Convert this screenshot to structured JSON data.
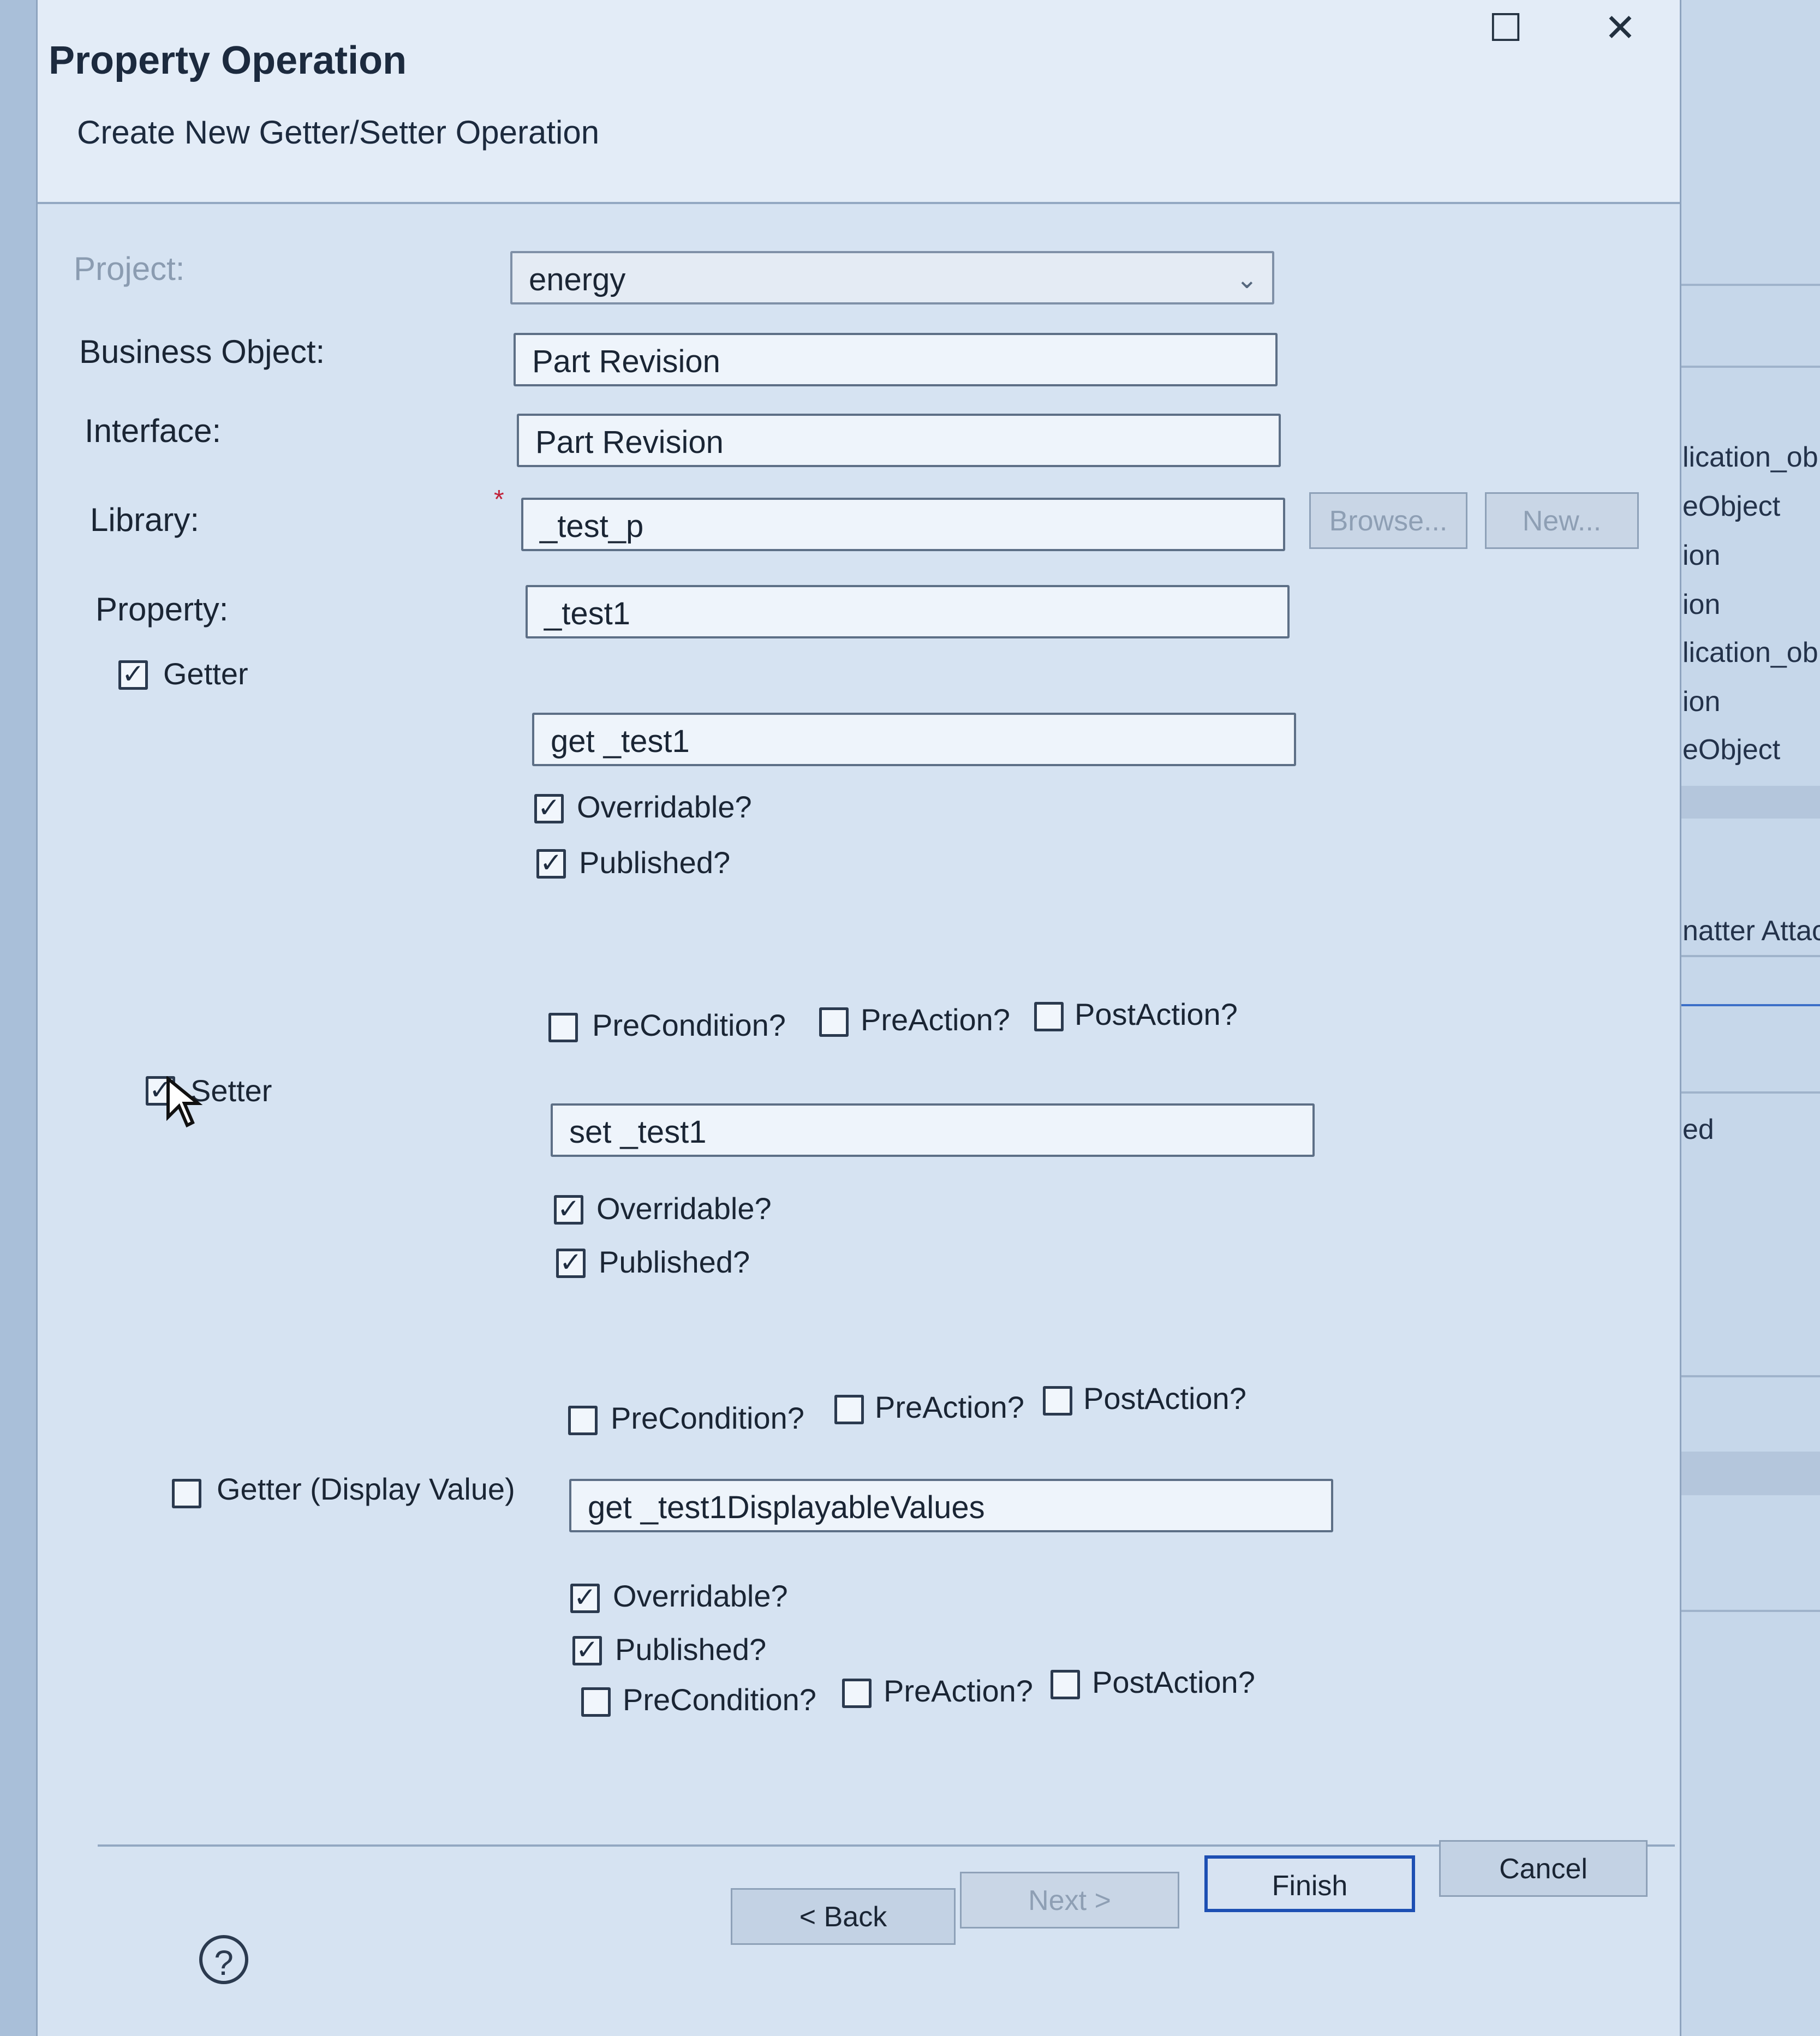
{
  "window": {
    "title": "Property Operation",
    "subtitle": "Create New Getter/Setter Operation",
    "maximize_glyph": "☐",
    "close_glyph": "✕"
  },
  "form": {
    "project": {
      "label": "Project:",
      "value": "energy"
    },
    "business_object": {
      "label": "Business Object:",
      "value": "Part Revision"
    },
    "interface": {
      "label": "Interface:",
      "value": "Part Revision"
    },
    "library": {
      "label": "Library:",
      "value": "_test_p",
      "required_mark": "*",
      "browse_label": "Browse...",
      "new_label": "New..."
    },
    "property": {
      "label": "Property:",
      "value": "_test1"
    }
  },
  "getter": {
    "label": "Getter",
    "checked": true,
    "name": "get _test1",
    "overridable_label": "Overridable?",
    "overridable": true,
    "published_label": "Published?",
    "published": true,
    "precondition_label": "PreCondition?",
    "preaction_label": "PreAction?",
    "postaction_label": "PostAction?"
  },
  "setter": {
    "label": "Setter",
    "checked": true,
    "name": "set _test1",
    "overridable_label": "Overridable?",
    "overridable": true,
    "published_label": "Published?",
    "published": true,
    "precondition_label": "PreCondition?",
    "preaction_label": "PreAction?",
    "postaction_label": "PostAction?"
  },
  "getter_display": {
    "label": "Getter (Display Value)",
    "checked": false,
    "name": "get _test1DisplayableValues",
    "overridable_label": "Overridable?",
    "overridable": true,
    "published_label": "Published?",
    "published": true,
    "precondition_label": "PreCondition?",
    "preaction_label": "PreAction?",
    "postaction_label": "PostAction?"
  },
  "footer": {
    "help_glyph": "?",
    "back_label": "< Back",
    "next_label": "Next >",
    "finish_label": "Finish",
    "cancel_label": "Cancel"
  },
  "background_panel": {
    "items": [
      "lication_ob",
      "eObject",
      "ion",
      "ion",
      "lication_ob",
      "ion",
      "eObject",
      "natter Attac",
      "ed"
    ]
  },
  "colors": {
    "accent": "#1d4fb3",
    "required": "#c0233a"
  }
}
